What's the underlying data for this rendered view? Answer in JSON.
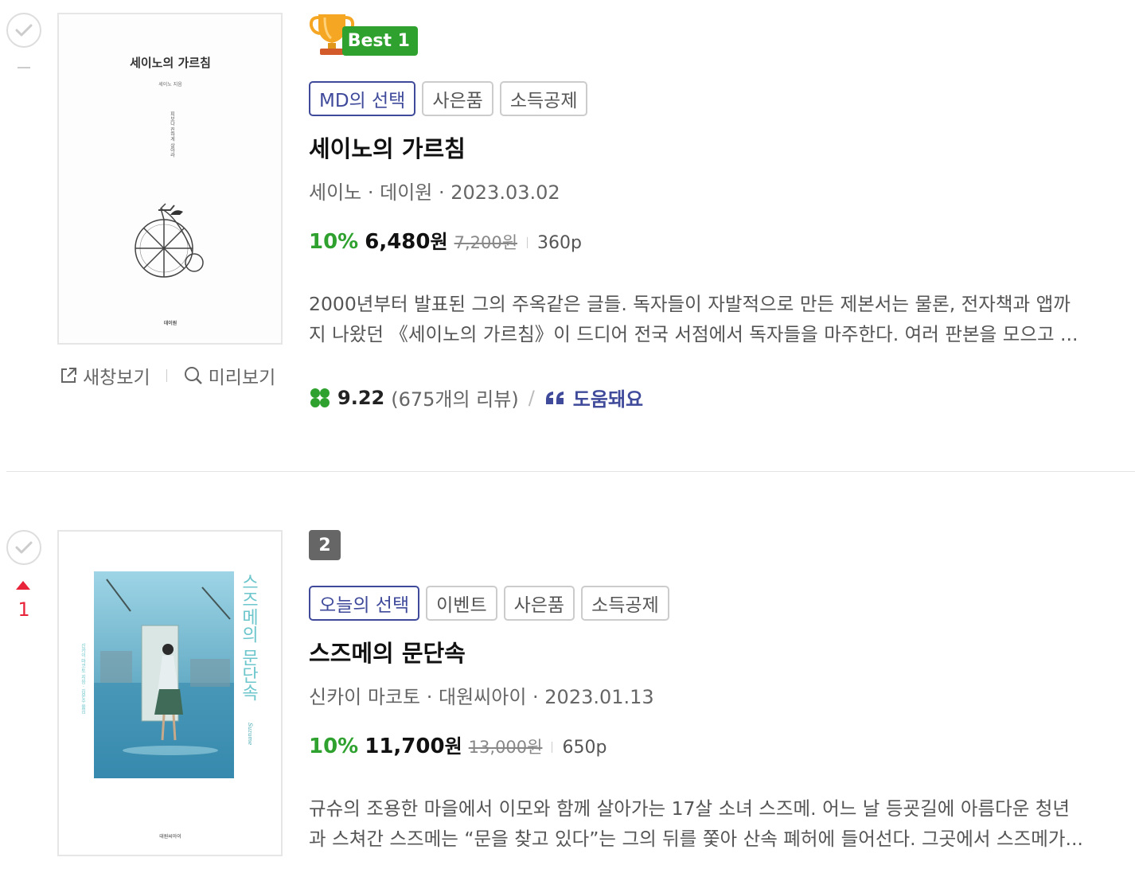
{
  "actions": {
    "new_window": "새창보기",
    "preview": "미리보기"
  },
  "books": [
    {
      "rank_change": "",
      "best_label": "Best 1",
      "tags": [
        "MD의 선택",
        "사은품",
        "소득공제"
      ],
      "title": "세이노의 가르침",
      "meta": "세이노 · 데이원 · 2023.03.02",
      "discount": "10%",
      "sale_price": "6,480",
      "won": "원",
      "original_price": "7,200원",
      "pages": "360p",
      "description_line1": "2000년부터 발표된 그의 주옥같은 글들. 독자들이 자발적으로 만든 제본서는 물론, 전자책과 앱까",
      "description_line2": "지 나왔던 《세이노의 가르침》이 드디어 전국 서점에서 독자들을 마주한다. 여러 판본을 모으고 ...",
      "rating": "9.22",
      "review_count": "(675개의 리뷰)",
      "helpful": "도움돼요",
      "cover_title": "세이노의 가르침",
      "cover_author": "세이노 지음",
      "cover_vertical": "피보다 진하게 살아라",
      "cover_publisher": "데이원"
    },
    {
      "rank_number": "2",
      "rank_change": "1",
      "tags": [
        "오늘의 선택",
        "이벤트",
        "사은품",
        "소득공제"
      ],
      "title": "스즈메의 문단속",
      "meta": "신카이 마코토 · 대원씨아이 · 2023.01.13",
      "discount": "10%",
      "sale_price": "11,700",
      "won": "원",
      "original_price": "13,000원",
      "pages": "650p",
      "description_line1": "규슈의 조용한 마을에서 이모와 함께 살아가는 17살 소녀 스즈메. 어느 날 등굣길에 아름다운 청년",
      "description_line2": "과 스쳐간 스즈메는 “문을 찾고 있다”는 그의 뒤를 쫓아 산속 폐허에 들어선다. 그곳에서 스즈메가...",
      "cover_title_vertical": "스즈메의 문단속",
      "cover_author_vertical": "신카이 마코토 지음 · 김윤수 옮김",
      "cover_brand": "Suzume",
      "cover_publisher": "대원씨아이"
    }
  ],
  "colors": {
    "green": "#2fa12f",
    "navy": "#3f4a9b",
    "red": "#e8243a"
  }
}
